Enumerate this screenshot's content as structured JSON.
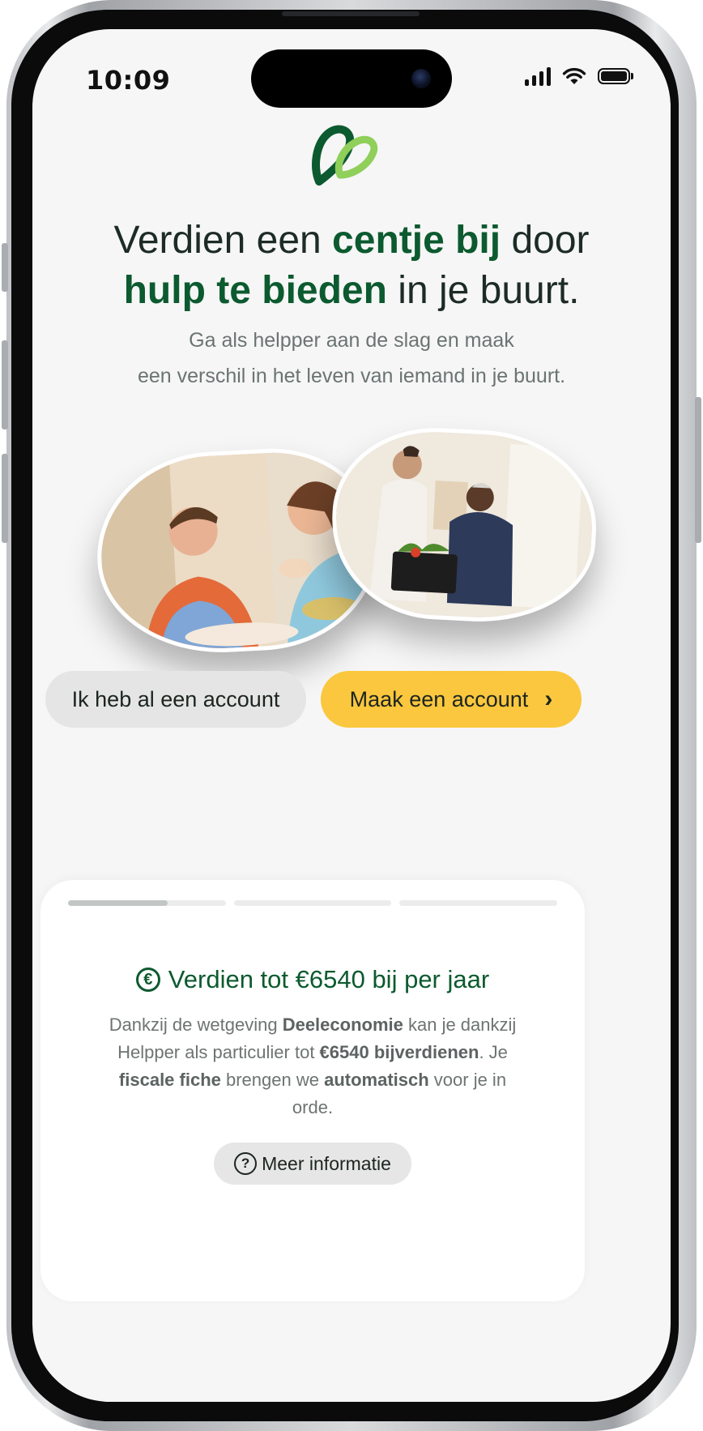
{
  "status_bar": {
    "time": "10:09"
  },
  "hero": {
    "headline": {
      "part1": "Verdien een ",
      "highlight1": "centje bij",
      "part2": " door",
      "highlight2": "hulp te bieden",
      "part3": " in je buurt."
    },
    "subtitle_line1": "Ga als helpper aan de slag en maak",
    "subtitle_line2": "een verschil in het leven van iemand in je buurt."
  },
  "photos": [
    {
      "name": "helper-baking-with-child"
    },
    {
      "name": "helper-carrying-groceries-for-elderly-man"
    }
  ],
  "actions": {
    "login_label": "Ik heb al een account",
    "create_label": "Maak een account",
    "create_chevron": "›"
  },
  "info_sheet": {
    "progress": {
      "segments": 3,
      "active_index": 0,
      "active_fill": 0.63
    },
    "title": "Verdien tot €6540 bij per jaar",
    "title_icon": "euro-icon",
    "body": {
      "t1": "Dankzij de wetgeving ",
      "b1": "Deeleconomie",
      "t2": " kan je dankzij Helpper als particulier tot ",
      "b2": "€6540 bijverdienen",
      "t3": ". Je ",
      "b3": "fiscale fiche",
      "t4": " brengen we ",
      "b4": "automatisch",
      "t5": " voor je in orde."
    },
    "more_label": "Meer informatie",
    "more_icon": "question-icon"
  },
  "colors": {
    "brand_green": "#0c5a2f",
    "brand_light_green": "#8fcf5a",
    "accent_yellow": "#fac73e",
    "secondary_button": "#e4e5e4",
    "background": "#f6f6f6"
  }
}
